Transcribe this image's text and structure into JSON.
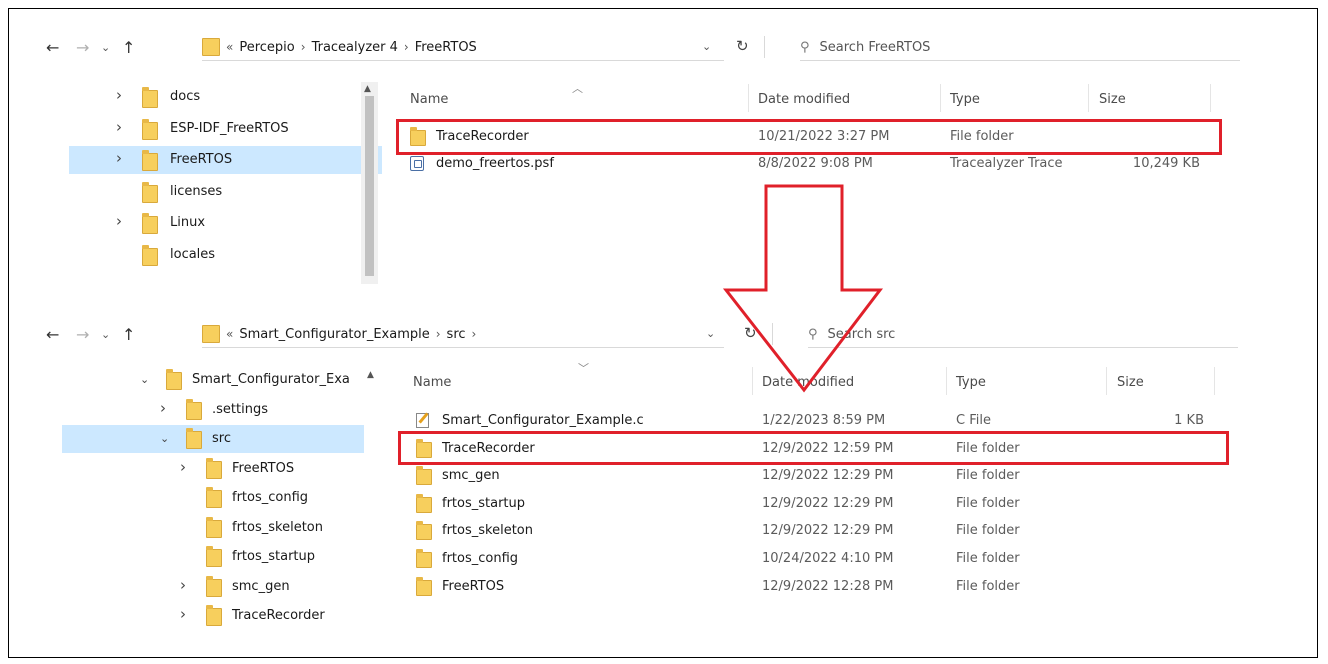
{
  "top_explorer": {
    "breadcrumb_overflow": "«",
    "breadcrumb": [
      "Percepio",
      "Tracealyzer 4",
      "FreeRTOS"
    ],
    "search_placeholder": "Search FreeRTOS",
    "tree": [
      {
        "label": "docs",
        "expander": true
      },
      {
        "label": "ESP-IDF_FreeRTOS",
        "expander": true
      },
      {
        "label": "FreeRTOS",
        "expander": true,
        "selected": true
      },
      {
        "label": "licenses",
        "expander": false
      },
      {
        "label": "Linux",
        "expander": true
      },
      {
        "label": "locales",
        "expander": false
      }
    ],
    "columns": {
      "name": "Name",
      "date": "Date modified",
      "type": "Type",
      "size": "Size"
    },
    "files": [
      {
        "name": "TraceRecorder",
        "date": "10/21/2022 3:27 PM",
        "type": "File folder",
        "size": "",
        "icon": "folder-icon"
      },
      {
        "name": "demo_freertos.psf",
        "date": "8/8/2022 9:08 PM",
        "type": "Tracealyzer Trace",
        "size": "10,249 KB",
        "icon": "psf-file-icon"
      }
    ]
  },
  "bottom_explorer": {
    "breadcrumb_overflow": "«",
    "breadcrumb": [
      "Smart_Configurator_Example",
      "src"
    ],
    "search_placeholder": "Search src",
    "tree": [
      {
        "label": "Smart_Configurator_Exa",
        "level": 0,
        "expander": "expanded"
      },
      {
        "label": ".settings",
        "level": 1,
        "expander": "collapsed"
      },
      {
        "label": "src",
        "level": 1,
        "expander": "expanded",
        "selected": true
      },
      {
        "label": "FreeRTOS",
        "level": 2,
        "expander": "collapsed"
      },
      {
        "label": "frtos_config",
        "level": 2,
        "expander": "none"
      },
      {
        "label": "frtos_skeleton",
        "level": 2,
        "expander": "none"
      },
      {
        "label": "frtos_startup",
        "level": 2,
        "expander": "none"
      },
      {
        "label": "smc_gen",
        "level": 2,
        "expander": "collapsed"
      },
      {
        "label": "TraceRecorder",
        "level": 2,
        "expander": "collapsed"
      }
    ],
    "columns": {
      "name": "Name",
      "date": "Date modified",
      "type": "Type",
      "size": "Size"
    },
    "files": [
      {
        "name": "Smart_Configurator_Example.c",
        "date": "1/22/2023 8:59 PM",
        "type": "C File",
        "size": "1 KB",
        "icon": "c-file-icon"
      },
      {
        "name": "TraceRecorder",
        "date": "12/9/2022 12:59 PM",
        "type": "File folder",
        "size": "",
        "icon": "folder-icon"
      },
      {
        "name": "smc_gen",
        "date": "12/9/2022 12:29 PM",
        "type": "File folder",
        "size": "",
        "icon": "folder-icon"
      },
      {
        "name": "frtos_startup",
        "date": "12/9/2022 12:29 PM",
        "type": "File folder",
        "size": "",
        "icon": "folder-icon"
      },
      {
        "name": "frtos_skeleton",
        "date": "12/9/2022 12:29 PM",
        "type": "File folder",
        "size": "",
        "icon": "folder-icon"
      },
      {
        "name": "frtos_config",
        "date": "10/24/2022 4:10 PM",
        "type": "File folder",
        "size": "",
        "icon": "folder-icon"
      },
      {
        "name": "FreeRTOS",
        "date": "12/9/2022 12:28 PM",
        "type": "File folder",
        "size": "",
        "icon": "folder-icon"
      }
    ]
  },
  "colors": {
    "highlight": "#e0202a",
    "selection": "#cce8ff",
    "folder": "#f7cf5d"
  }
}
